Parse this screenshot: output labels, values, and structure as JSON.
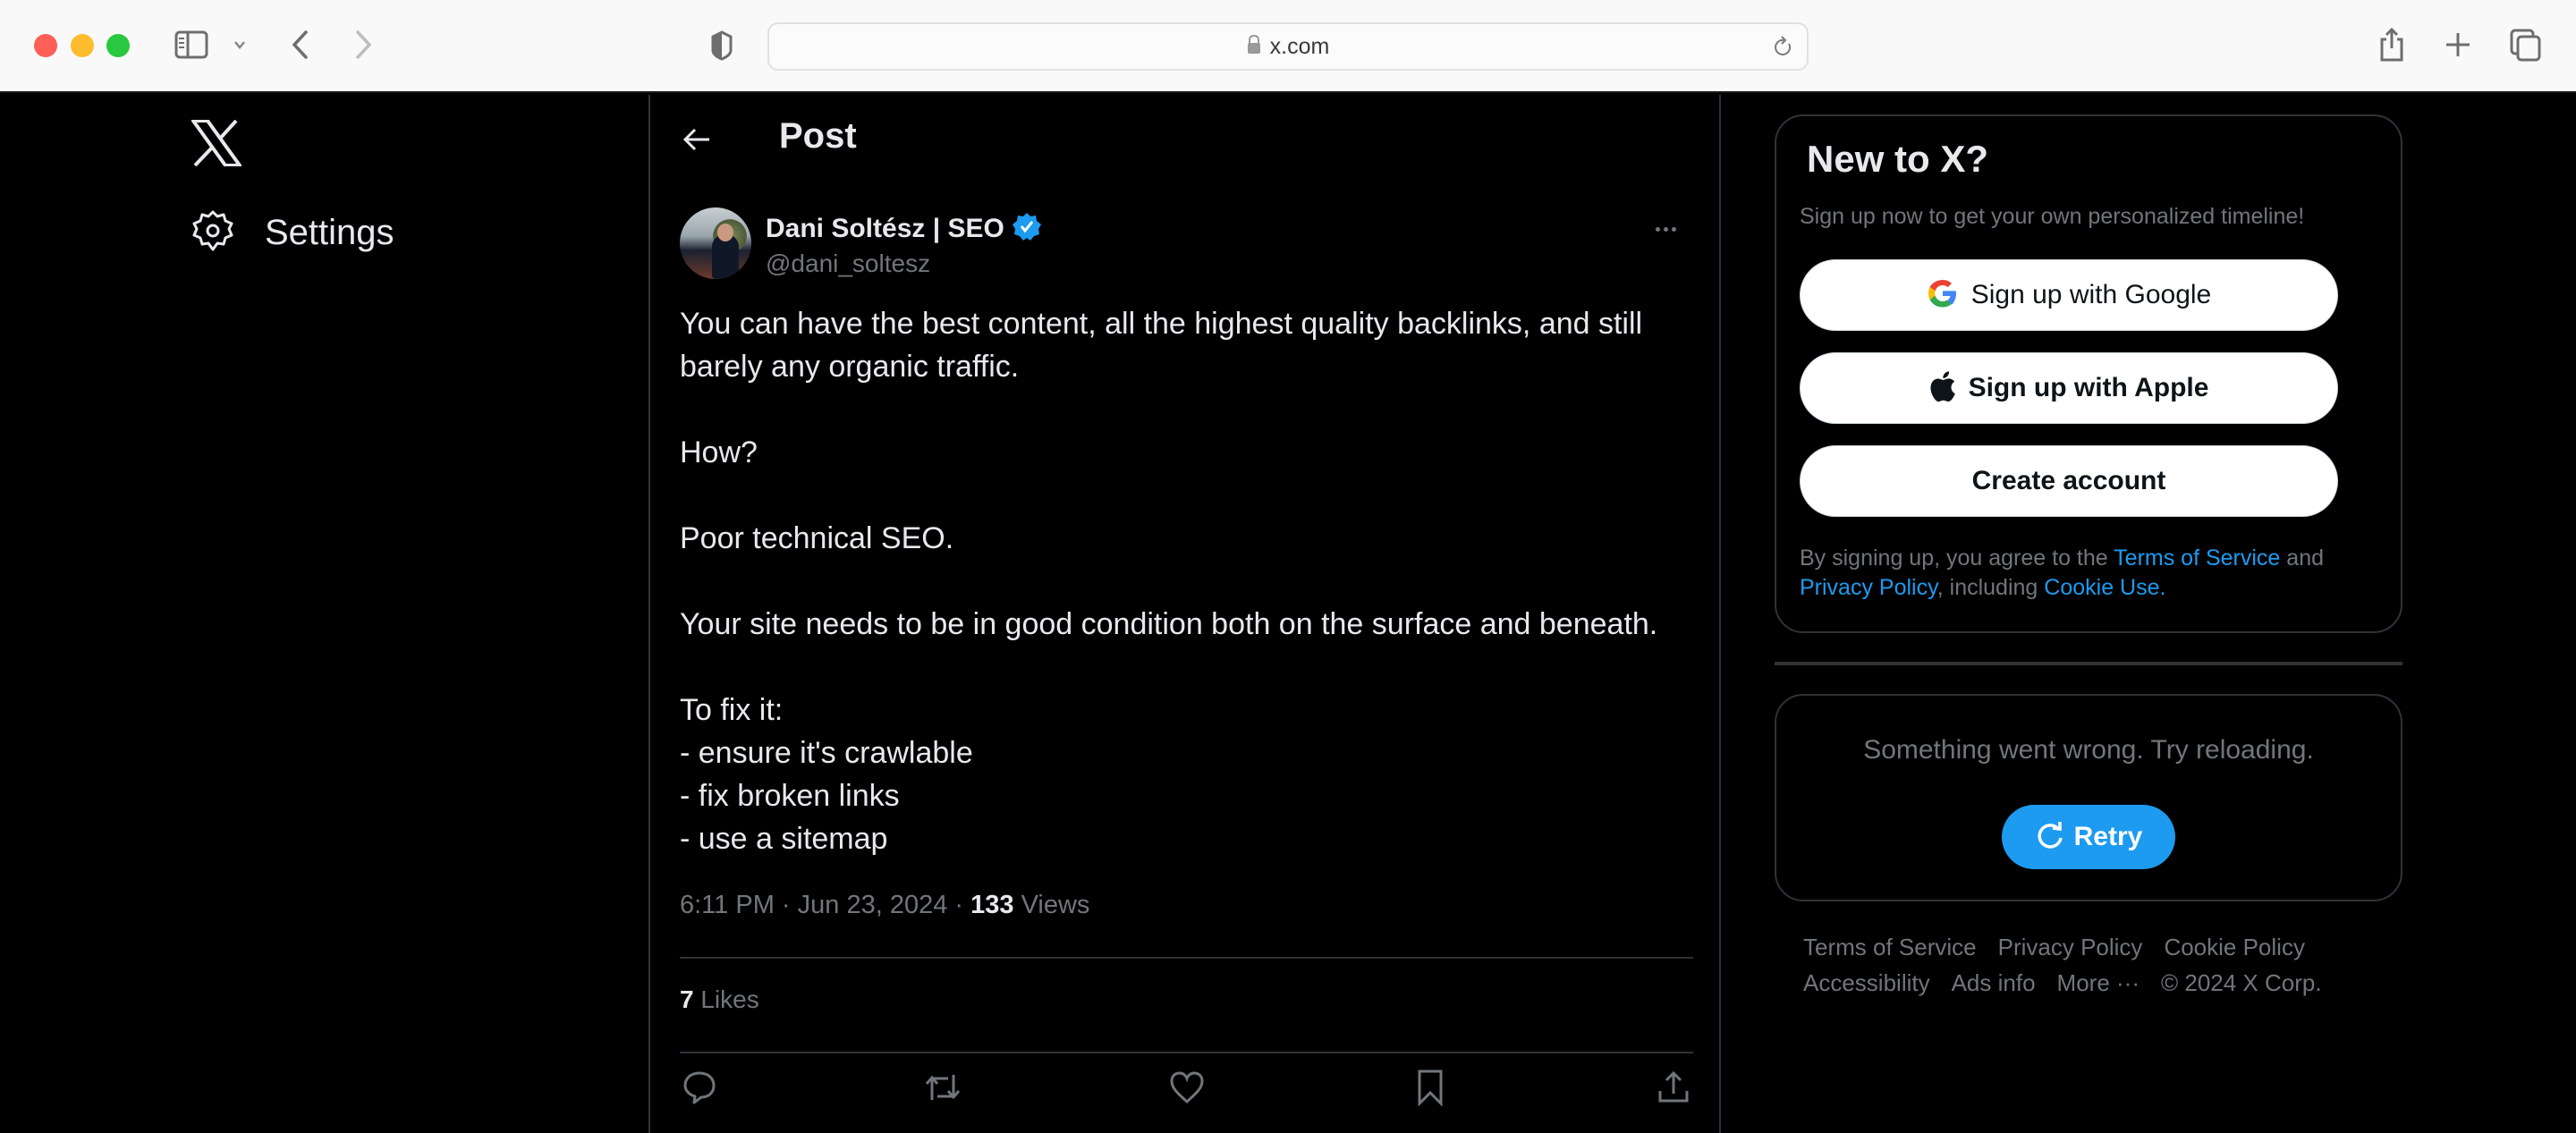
{
  "browser": {
    "url": "x.com",
    "icons": [
      "sidebar-icon",
      "chevron-down-icon",
      "back-icon",
      "forward-icon",
      "shield-icon",
      "lock-icon",
      "reload-icon",
      "share-icon",
      "new-tab-icon",
      "tabs-overview-icon"
    ]
  },
  "nav": {
    "logo": "X",
    "settings_label": "Settings"
  },
  "post_header": {
    "title": "Post"
  },
  "post": {
    "author_name": "Dani Soltész | SEO",
    "verified": true,
    "handle": "@dani_soltesz",
    "body": [
      "You can have the best content, all the highest quality backlinks, and still barely any organic traffic.",
      "",
      "How?",
      "",
      "Poor technical SEO.",
      "",
      "Your site needs to be in good condition both on the surface and beneath.",
      "",
      "To fix it:",
      "- ensure it's crawlable",
      "- fix broken links",
      "- use a sitemap"
    ],
    "time": "6:11 PM",
    "date": "Jun 23, 2024",
    "views_count": "133",
    "views_label": "Views",
    "likes_count": "7",
    "likes_label": "Likes",
    "actions": [
      "reply",
      "repost",
      "like",
      "bookmark",
      "share"
    ]
  },
  "signup": {
    "title": "New to X?",
    "subtitle": "Sign up now to get your own personalized timeline!",
    "google_label": "Sign up with Google",
    "apple_label": "Sign up with Apple",
    "create_label": "Create account",
    "legal_prefix": "By signing up, you agree to the ",
    "terms_link": "Terms of Service",
    "legal_and": " and ",
    "privacy_link": "Privacy Policy",
    "legal_including": ", including ",
    "cookie_link": "Cookie Use."
  },
  "error_card": {
    "message": "Something went wrong. Try reloading.",
    "retry_label": "Retry"
  },
  "footer": {
    "links": [
      "Terms of Service",
      "Privacy Policy",
      "Cookie Policy",
      "Accessibility",
      "Ads info",
      "More ···"
    ],
    "copyright": "© 2024 X Corp."
  },
  "colors": {
    "accent": "#1d9bf0",
    "background": "#000000",
    "text_primary": "#e7e9ea",
    "text_secondary": "#71767b",
    "border": "#2f3336"
  }
}
